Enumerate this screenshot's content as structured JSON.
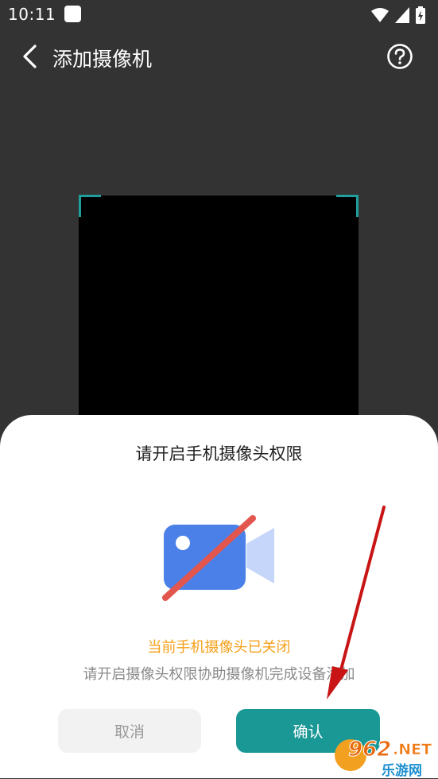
{
  "status_bar": {
    "time": "10:11"
  },
  "header": {
    "title": "添加摄像机"
  },
  "permission_sheet": {
    "title": "请开启手机摄像头权限",
    "status_message": "当前手机摄像头已关闭",
    "hint_message": "请开启摄像头权限协助摄像机完成设备添加",
    "cancel_label": "取消",
    "confirm_label": "确认"
  },
  "watermark": {
    "number": "962",
    "domain": ".NET",
    "site_name": "乐游网"
  },
  "colors": {
    "accent": "#1a9896",
    "warning": "#f5a11c",
    "camera_icon": "#4a80e8",
    "camera_icon_light": "#c5d6fa",
    "slash": "#e2564e"
  }
}
